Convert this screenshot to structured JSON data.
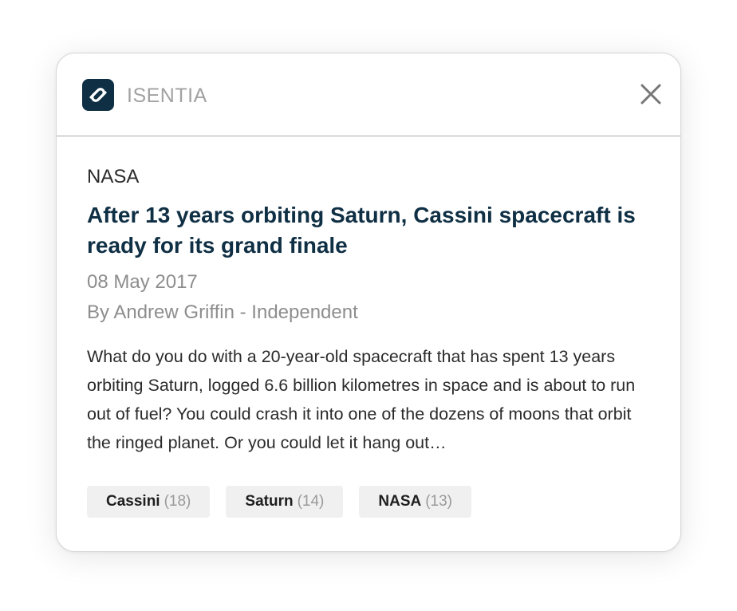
{
  "header": {
    "brand": "ISENTIA"
  },
  "article": {
    "source": "NASA",
    "title": "After 13 years orbiting Saturn, Cassini spacecraft is ready for its grand finale",
    "date": "08 May 2017",
    "byline": "By Andrew Griffin - Independent",
    "summary": "What do you do with a 20-year-old spacecraft that has spent 13 years orbiting Saturn, logged 6.6 billion kilometres in space and is about to run out of fuel? You could crash it into one of the dozens of moons that orbit the ringed planet. Or you could let it hang out…"
  },
  "tags": [
    {
      "name": "Cassini",
      "count": "(18)"
    },
    {
      "name": "Saturn",
      "count": "(14)"
    },
    {
      "name": "NASA",
      "count": "(13)"
    }
  ],
  "icons": {
    "logo": "isentia-logo-icon",
    "close": "close-icon"
  },
  "colors": {
    "brand_navy": "#0f2f44",
    "muted_text": "#8d8d8d",
    "tag_background": "#f0f0f0"
  }
}
